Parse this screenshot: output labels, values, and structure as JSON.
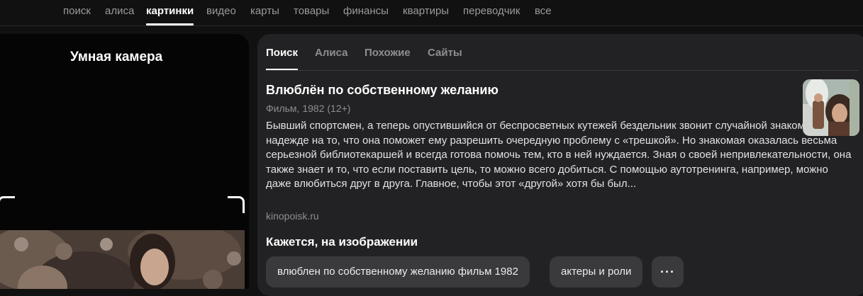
{
  "topnav": {
    "items": [
      {
        "label": "поиск",
        "active": false
      },
      {
        "label": "алиса",
        "active": false
      },
      {
        "label": "картинки",
        "active": true
      },
      {
        "label": "видео",
        "active": false
      },
      {
        "label": "карты",
        "active": false
      },
      {
        "label": "товары",
        "active": false
      },
      {
        "label": "финансы",
        "active": false
      },
      {
        "label": "квартиры",
        "active": false
      },
      {
        "label": "переводчик",
        "active": false
      },
      {
        "label": "все",
        "active": false
      }
    ]
  },
  "left_panel": {
    "title": "Умная камера"
  },
  "result_card": {
    "tabs": [
      {
        "label": "Поиск",
        "active": true
      },
      {
        "label": "Алиса",
        "active": false
      },
      {
        "label": "Похожие",
        "active": false
      },
      {
        "label": "Сайты",
        "active": false
      }
    ],
    "film": {
      "title": "Влюблён по собственному желанию",
      "meta": "Фильм, 1982 (12+)",
      "description": "Бывший спортсмен, а теперь опустившийся от беспросветных кутежей бездельник звонит случайной знакомой в надежде на то, что она поможет ему разрешить очередную проблему с «трешкой». Но знакомая оказалась весьма серьезной библиотекаршей и всегда готова помочь тем, кто в ней нуждается. Зная о своей непривлекательности, она также знает и то, что если поставить цель, то можно всего добиться. С помощью аутотренинга, например, можно даже влюбиться друг в друга. Главное, чтобы этот «другой» хотя бы был...",
      "source": "kinopoisk.ru"
    },
    "section_title": "Кажется, на изображении",
    "chips": [
      {
        "label": "влюблен по собственному желанию фильм 1982"
      },
      {
        "label": "актеры и роли"
      },
      {
        "label": "···"
      }
    ]
  },
  "colors": {
    "background": "#111112",
    "card": "#222224",
    "chip": "#3a3a3c",
    "muted_text": "#8e8e92"
  }
}
